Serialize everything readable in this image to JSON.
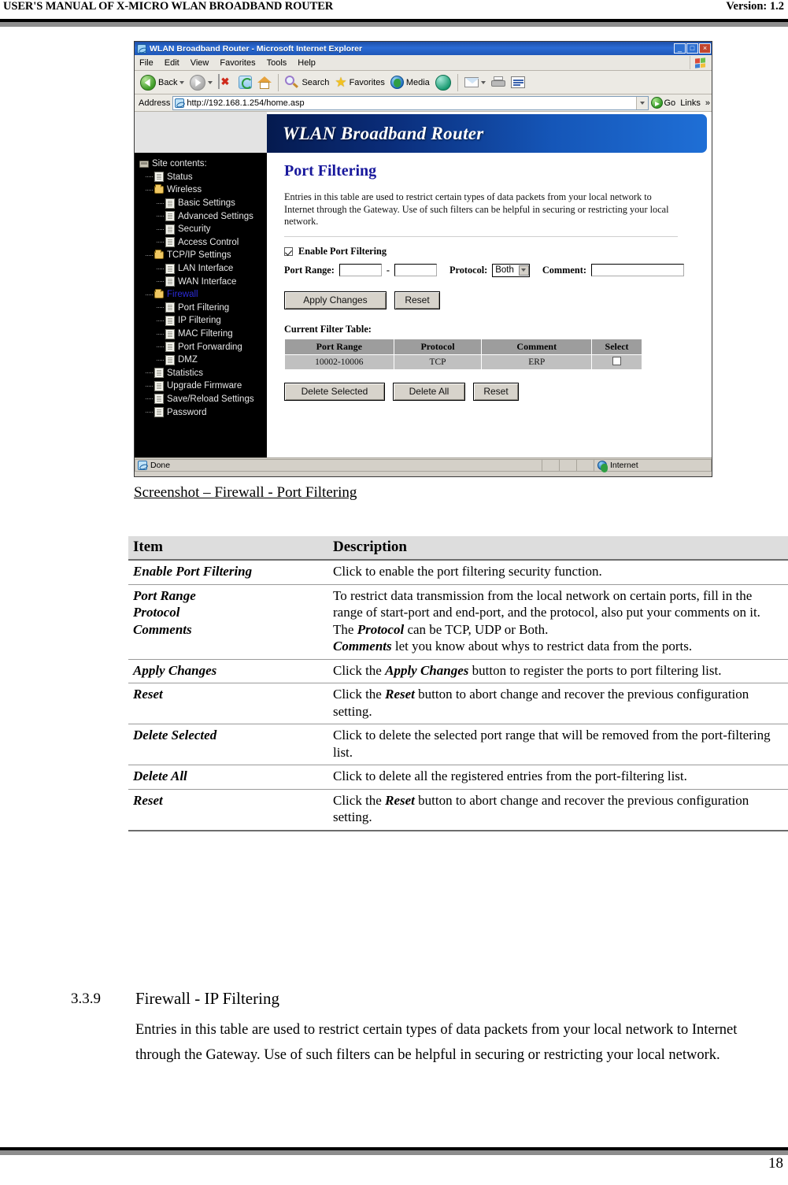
{
  "header": {
    "left": "USER'S MANUAL OF X-MICRO WLAN BROADBAND ROUTER",
    "right": "Version: 1.2"
  },
  "browser": {
    "window_title": "WLAN Broadband Router - Microsoft Internet Explorer",
    "window_buttons": {
      "minimize": "_",
      "maximize": "□",
      "close": "×"
    },
    "menu": [
      "File",
      "Edit",
      "View",
      "Favorites",
      "Tools",
      "Help"
    ],
    "toolbar": {
      "back": "Back",
      "search": "Search",
      "favorites": "Favorites",
      "media": "Media"
    },
    "address": {
      "label": "Address",
      "url": "http://192.168.1.254/home.asp",
      "go": "Go",
      "links": "Links"
    },
    "statusbar": {
      "status": "Done",
      "zone": "Internet"
    }
  },
  "router_ui": {
    "banner_title": "WLAN Broadband Router",
    "sidebar": {
      "root": "Site contents:",
      "items": [
        {
          "label": "Status",
          "icon": "page-icon",
          "level": 1,
          "highlight": false
        },
        {
          "label": "Wireless",
          "icon": "folder-icon",
          "level": 1,
          "highlight": false
        },
        {
          "label": "Basic Settings",
          "icon": "page-icon",
          "level": 2,
          "highlight": false
        },
        {
          "label": "Advanced Settings",
          "icon": "page-icon",
          "level": 2,
          "highlight": false
        },
        {
          "label": "Security",
          "icon": "page-icon",
          "level": 2,
          "highlight": false
        },
        {
          "label": "Access Control",
          "icon": "page-icon",
          "level": 2,
          "highlight": false
        },
        {
          "label": "TCP/IP Settings",
          "icon": "folder-icon",
          "level": 1,
          "highlight": false
        },
        {
          "label": "LAN Interface",
          "icon": "page-icon",
          "level": 2,
          "highlight": false
        },
        {
          "label": "WAN Interface",
          "icon": "page-icon",
          "level": 2,
          "highlight": false
        },
        {
          "label": "Firewall",
          "icon": "folder-icon",
          "level": 1,
          "highlight": true
        },
        {
          "label": "Port Filtering",
          "icon": "page-icon",
          "level": 2,
          "highlight": false
        },
        {
          "label": "IP Filtering",
          "icon": "page-icon",
          "level": 2,
          "highlight": false
        },
        {
          "label": "MAC Filtering",
          "icon": "page-icon",
          "level": 2,
          "highlight": false
        },
        {
          "label": "Port Forwarding",
          "icon": "page-icon",
          "level": 2,
          "highlight": false
        },
        {
          "label": "DMZ",
          "icon": "page-icon",
          "level": 2,
          "highlight": false
        },
        {
          "label": "Statistics",
          "icon": "page-icon",
          "level": 1,
          "highlight": false
        },
        {
          "label": "Upgrade Firmware",
          "icon": "page-icon",
          "level": 1,
          "highlight": false
        },
        {
          "label": "Save/Reload Settings",
          "icon": "page-icon",
          "level": 1,
          "highlight": false
        },
        {
          "label": "Password",
          "icon": "page-icon",
          "level": 1,
          "highlight": false
        }
      ]
    },
    "page": {
      "title": "Port Filtering",
      "intro": "Entries in this table are used to restrict certain types of data packets from your local network to Internet through the Gateway. Use of such filters can be helpful in securing or restricting your local network.",
      "enable_label": "Enable Port Filtering",
      "enable_checked": true,
      "port_range_label": "Port Range:",
      "port_range_start": "",
      "port_range_end": "",
      "range_separator": "-",
      "protocol_label": "Protocol:",
      "protocol_value": "Both",
      "protocol_options": [
        "TCP",
        "UDP",
        "Both"
      ],
      "comment_label": "Comment:",
      "comment_value": "",
      "apply_button": "Apply Changes",
      "reset_button": "Reset",
      "table_label": "Current Filter Table:",
      "table_headers": [
        "Port Range",
        "Protocol",
        "Comment",
        "Select"
      ],
      "table_rows": [
        {
          "port_range": "10002-10006",
          "protocol": "TCP",
          "comment": "ERP",
          "selected": false
        }
      ],
      "delete_selected_button": "Delete Selected",
      "delete_all_button": "Delete All",
      "reset_button_2": "Reset"
    }
  },
  "caption": "Screenshot – Firewall - Port Filtering",
  "doc_table": {
    "headers": [
      "Item",
      "Description"
    ],
    "rows": [
      {
        "item": "Enable Port Filtering",
        "desc_html": "Click to enable the port filtering security function."
      },
      {
        "item": "Port Range\nProtocol\nComments",
        "desc_html": "To restrict data transmission from the local network on certain ports, fill in the range of start-port and end-port, and the protocol, also put your comments on it.<br>The <b>Protocol</b> can be TCP, UDP or Both.<br><b>Comments</b> let you know about whys to restrict data from the ports."
      },
      {
        "item": "Apply Changes",
        "desc_html": "Click the <b>Apply Changes</b> button to register the ports to port filtering list."
      },
      {
        "item": "Reset",
        "desc_html": "Click the <b>Reset</b> button to abort change and recover the previous configuration setting."
      },
      {
        "item": "Delete Selected",
        "desc_html": "Click to delete the selected port range that will be removed from the port-filtering list."
      },
      {
        "item": "Delete All",
        "desc_html": "Click to delete all the registered entries from the port-filtering list."
      },
      {
        "item": "Reset",
        "desc_html": "Click the <b>Reset</b> button to abort change and recover the previous configuration setting."
      }
    ]
  },
  "section": {
    "number": "3.3.9",
    "title": "Firewall - IP Filtering",
    "body": "Entries in this table are used to restrict certain types of data packets from your local network to Internet through the Gateway. Use of such filters can be helpful in securing or restricting your local network."
  },
  "footer": {
    "page_number": "18"
  }
}
